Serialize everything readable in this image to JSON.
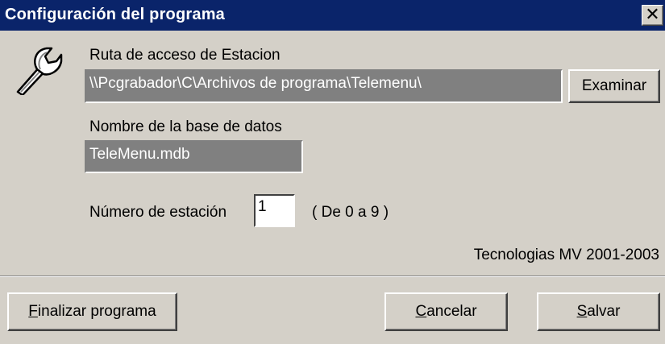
{
  "window": {
    "title": "Configuración del programa",
    "close_glyph": "✕"
  },
  "icon": "wrench-icon",
  "path": {
    "label": "Ruta de acceso de Estacion",
    "value": "\\\\Pcgrabador\\C\\Archivos de programa\\Telemenu\\",
    "browse_label": "Examinar"
  },
  "database": {
    "label": "Nombre de la base de datos",
    "value": "TeleMenu.mdb"
  },
  "station": {
    "label": "Número de estación",
    "value": "1",
    "range_hint": "( De 0 a 9 )"
  },
  "footer": {
    "copyright": "Tecnologias MV 2001-2003"
  },
  "buttons": {
    "finish": {
      "accel": "F",
      "rest": "inalizar programa"
    },
    "cancel": {
      "accel": "C",
      "rest": "ancelar"
    },
    "save": {
      "accel": "S",
      "rest": "alvar"
    }
  },
  "colors": {
    "titlebar": "#0a246a",
    "face": "#d4d0c8",
    "readonly_field": "#808080"
  }
}
